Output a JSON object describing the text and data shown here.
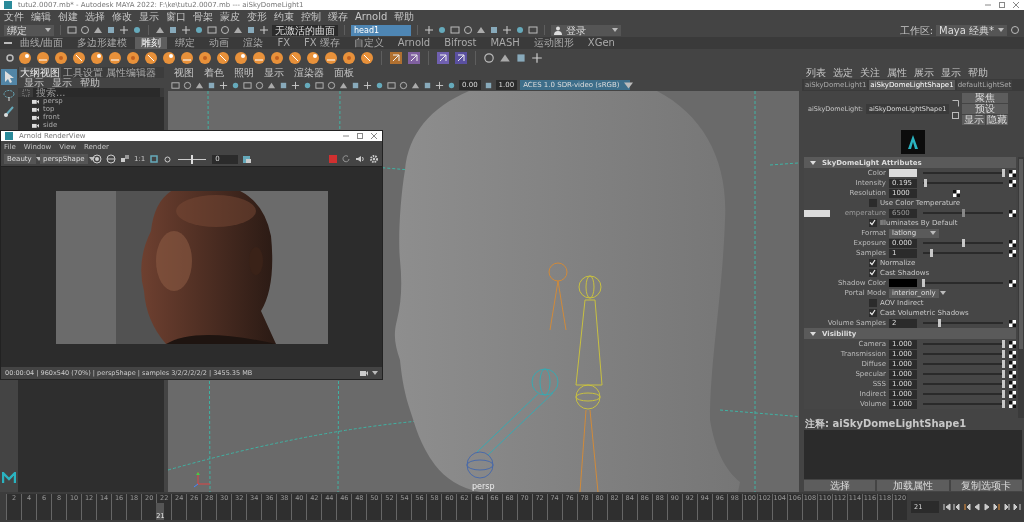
{
  "window": {
    "title": "tutu2.0007.mb* - Autodesk MAYA 2022: F:\\ke\\tutu2.0007.mb  ---  aiSkyDomeLight1"
  },
  "menu_bar": [
    "文件",
    "编辑",
    "创建",
    "选择",
    "修改",
    "显示",
    "窗口",
    "骨架",
    "蒙皮",
    "变形",
    "约束",
    "控制",
    "缓存",
    "Arnold",
    "帮助"
  ],
  "status_line": {
    "menu_set": "绑定",
    "surface_field": "无激活的曲面",
    "name_field": "head1",
    "login": "登录",
    "workspace_label": "工作区:",
    "workspace": "Maya 经典*"
  },
  "shelf": {
    "tabs": [
      {
        "label": "曲线/曲面",
        "selected": false
      },
      {
        "label": "多边形建模",
        "selected": false
      },
      {
        "label": "雕刻",
        "selected": true
      },
      {
        "label": "绑定",
        "selected": false
      },
      {
        "label": "动画",
        "selected": false
      },
      {
        "label": "渲染",
        "selected": false
      },
      {
        "label": "FX",
        "selected": false
      },
      {
        "label": "FX 缓存",
        "selected": false
      },
      {
        "label": "自定义",
        "selected": false
      },
      {
        "label": "Arnold",
        "selected": false
      },
      {
        "label": "Bifrost",
        "selected": false
      },
      {
        "label": "MASH",
        "selected": false
      },
      {
        "label": "运动图形",
        "selected": false
      },
      {
        "label": "XGen",
        "selected": false
      }
    ]
  },
  "outliner": {
    "tabs": [
      {
        "label": "大纲视图",
        "selected": true
      },
      {
        "label": "工具设置",
        "selected": false
      },
      {
        "label": "属性编辑器",
        "selected": false
      }
    ],
    "menu": [
      "显示",
      "显示",
      "帮助"
    ],
    "search_placeholder": "搜索...",
    "items": [
      "persp",
      "top",
      "front",
      "side"
    ]
  },
  "viewport": {
    "menu": [
      "视图",
      "着色",
      "照明",
      "显示",
      "渲染器",
      "面板"
    ],
    "fields": [
      "0.00",
      "1.00"
    ],
    "color_space": "ACES 1.0 SDR-video (sRGB)",
    "camera_label": "persp"
  },
  "render_view": {
    "title": "Arnold RenderView",
    "menu": [
      "File",
      "Window",
      "View",
      "Render"
    ],
    "aov": "Beauty",
    "camera": "perspShape",
    "ratio": "1:1",
    "exposure": {
      "value": "0",
      "level": 0.5
    },
    "status": "00:00:04 | 960x540 (70%) | perspShape | samples 3/2/2/2/2/2 | 3455.35 MB"
  },
  "attribute_editor": {
    "menu": [
      "列表",
      "选定",
      "关注",
      "属性",
      "展示",
      "显示",
      "帮助"
    ],
    "tabs": [
      {
        "label": "aiSkyDomeLight1",
        "selected": false
      },
      {
        "label": "aiSkyDomeLightShape1",
        "selected": true
      },
      {
        "label": "defaultLightSet",
        "selected": false
      }
    ],
    "node_label": "aiSkyDomeLight:",
    "node_name": "aiSkyDomeLightShape1",
    "buttons": [
      "聚焦",
      "预设",
      "显示",
      "隐藏"
    ],
    "sections": [
      {
        "title": "SkyDomeLight Attributes",
        "expanded": true,
        "rows": [
          {
            "kind": "color",
            "label": "Color",
            "color": "#dcdcdc",
            "level": 1
          },
          {
            "kind": "slider",
            "label": "Intensity",
            "value": "0.195",
            "level": 0.03
          },
          {
            "kind": "number",
            "label": "Resolution",
            "value": "1000"
          },
          {
            "kind": "check",
            "label": "Use Color Temperature",
            "checked": false
          },
          {
            "kind": "temperature",
            "label": "emperature",
            "value": "6500",
            "color": "#dcdcdc",
            "level": 0.5,
            "disabled": true
          },
          {
            "kind": "check",
            "label": "Illuminates By Default",
            "checked": true
          },
          {
            "kind": "dropdown",
            "label": "Format",
            "value": "latlong"
          },
          {
            "kind": "slider",
            "label": "Exposure",
            "value": "0.000",
            "level": 0.5
          },
          {
            "kind": "slider",
            "label": "Samples",
            "value": "1",
            "level": 0.1
          },
          {
            "kind": "check",
            "label": "Normalize",
            "checked": true
          },
          {
            "kind": "check",
            "label": "Cast Shadows",
            "checked": true
          },
          {
            "kind": "color",
            "label": "Shadow Color",
            "color": "#000000",
            "level": 0
          },
          {
            "kind": "dropdown",
            "label": "Portal Mode",
            "value": "interior_only"
          },
          {
            "kind": "check",
            "label": "AOV Indirect",
            "checked": false
          },
          {
            "kind": "check",
            "label": "Cast Volumetric Shadows",
            "checked": true
          },
          {
            "kind": "slider",
            "label": "Volume Samples",
            "value": "2",
            "level": 0.2
          }
        ]
      },
      {
        "title": "Visibility",
        "expanded": true,
        "rows": [
          {
            "kind": "slider",
            "label": "Camera",
            "value": "1.000",
            "level": 1
          },
          {
            "kind": "slider",
            "label": "Transmission",
            "value": "1.000",
            "level": 1
          },
          {
            "kind": "slider",
            "label": "Diffuse",
            "value": "1.000",
            "level": 1
          },
          {
            "kind": "slider",
            "label": "Specular",
            "value": "1.000",
            "level": 1
          },
          {
            "kind": "slider",
            "label": "SSS",
            "value": "1.000",
            "level": 1
          },
          {
            "kind": "slider",
            "label": "Indirect",
            "value": "1.000",
            "level": 1
          },
          {
            "kind": "slider",
            "label": "Volume",
            "value": "1.000",
            "level": 1
          }
        ]
      }
    ],
    "notes_label": "注释: aiSkyDomeLightShape1",
    "bottom_buttons": [
      "选择",
      "加载属性",
      "复制选项卡"
    ]
  },
  "timeline": {
    "ticks": [
      "2",
      "4",
      "6",
      "8",
      "10",
      "12",
      "14",
      "16",
      "18",
      "20",
      "22",
      "24",
      "26",
      "28",
      "30",
      "32",
      "34",
      "36",
      "38",
      "40",
      "42",
      "44",
      "46",
      "48",
      "50",
      "52",
      "54",
      "56",
      "58",
      "60",
      "62",
      "64",
      "66",
      "68",
      "70",
      "72",
      "74",
      "76",
      "78",
      "80",
      "82",
      "84",
      "86",
      "88",
      "90",
      "92",
      "94",
      "96",
      "98",
      "100",
      "102",
      "104",
      "106",
      "108",
      "110",
      "112",
      "114",
      "116",
      "118",
      "120"
    ],
    "playhead": {
      "label": "21",
      "level": 0.167
    },
    "frame_field": "21"
  }
}
